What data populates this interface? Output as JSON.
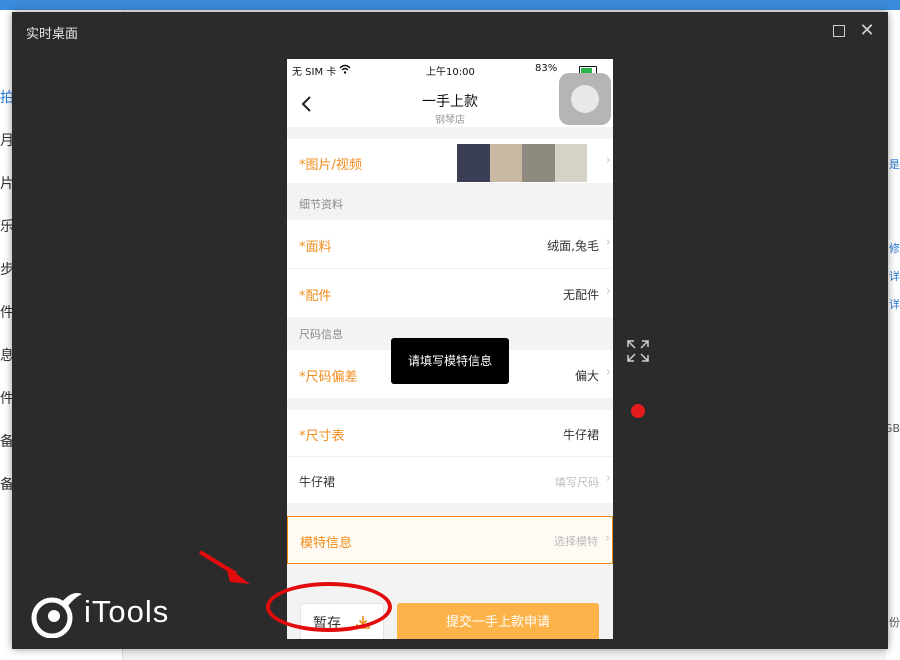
{
  "background_app": {
    "sidebar_fragments": [
      "拍",
      "月",
      "片",
      "乐",
      "步",
      "件",
      "息",
      "件",
      "备",
      "备"
    ],
    "right_fragments_blue": [
      "是",
      "修",
      "详",
      "详"
    ],
    "right_fragment_gray": [
      "GB",
      "份"
    ]
  },
  "window": {
    "title": "实时桌面",
    "maximize_icon": "maximize-icon",
    "close_icon": "close-icon",
    "close_glyph": "✕"
  },
  "phone": {
    "status": {
      "carrier": "无 SIM 卡",
      "time": "上午10:00",
      "battery": "83%"
    },
    "nav": {
      "title": "一手上款",
      "subtitle": "钢琴店"
    },
    "rows": {
      "media_label": "*图片/视频",
      "section_detail": "细节资料",
      "fabric_label": "*面料",
      "fabric_value": "绒面,兔毛",
      "accessory_label": "*配件",
      "accessory_value": "无配件",
      "section_size": "尺码信息",
      "size_bias_label": "*尺码偏差",
      "size_bias_value": "偏大",
      "size_table_label": "*尺寸表",
      "size_table_value": "牛仔裙",
      "size_item_label": "牛仔裙",
      "size_item_hint": "填写尺码",
      "model_label": "模特信息",
      "model_hint": "选择模特"
    },
    "toast": "请填写模特信息",
    "bottom": {
      "save_label": "暂存",
      "submit_label": "提交一手上款申请"
    }
  },
  "logo_text": "iTools",
  "colors": {
    "accent_orange": "#f08c1a",
    "submit_button": "#fbb34a",
    "annotation_red": "#e20c0c",
    "window_bg": "#2b2b2b"
  }
}
